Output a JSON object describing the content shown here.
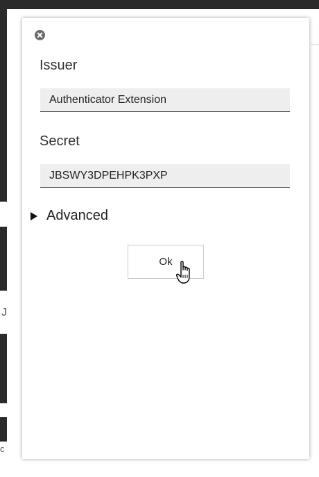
{
  "dialog": {
    "issuer": {
      "label": "Issuer",
      "value": "Authenticator Extension"
    },
    "secret": {
      "label": "Secret",
      "value": "JBSWY3DPEHPK3PXP"
    },
    "advanced_label": "Advanced",
    "ok_label": "Ok"
  },
  "background": {
    "fragment_1": "J",
    "fragment_2": "c"
  },
  "icons": {
    "close": "close-circle-icon",
    "advanced": "disclosure-triangle-icon",
    "cursor": "hand-pointer-cursor"
  },
  "colors": {
    "input_bg": "#eeeeee",
    "backdrop_dark": "#2b2b2b"
  }
}
